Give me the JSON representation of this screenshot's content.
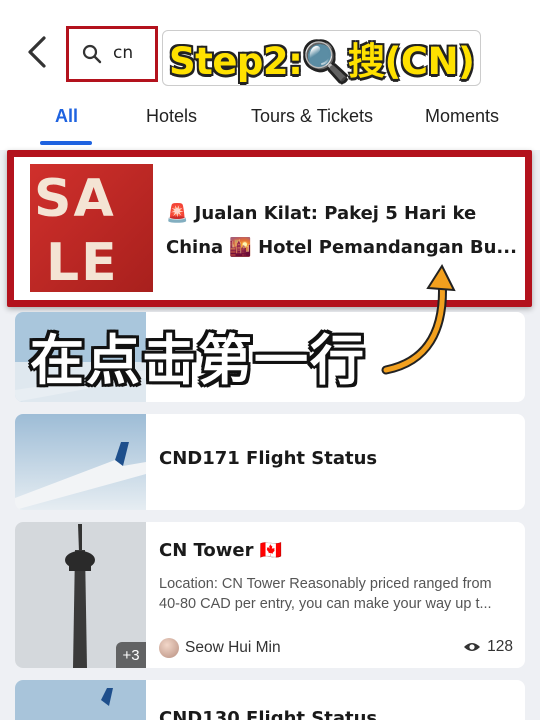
{
  "search": {
    "query": "cn"
  },
  "banner": {
    "step_text": "Step2:🔍搜(CN)"
  },
  "tabs": [
    {
      "label": "All",
      "active": true
    },
    {
      "label": "Hotels",
      "active": false
    },
    {
      "label": "Tours & Tickets",
      "active": false
    },
    {
      "label": "Moments",
      "active": false
    }
  ],
  "results": [
    {
      "title_line1": "🚨 Jualan Kilat: Pakej 5 Hari ke",
      "title_line2": "China 🌇 Hotel Pemandangan Bu...",
      "thumb_text": "SALE"
    },
    {
      "title": "CND171 Flight Status"
    },
    {
      "title": "CN Tower 🇨🇦",
      "description": "Location: CN Tower  Reasonably priced ranged from 40-80 CAD per entry, you can make your way up t...",
      "author": "Seow Hui Min",
      "views": "128",
      "more_images": "+3"
    },
    {
      "title": "CND130 Flight Status"
    }
  ],
  "overlay": {
    "instruction": "在点击第一行"
  },
  "colors": {
    "accent": "#1f63e0",
    "highlight": "#b3121d",
    "banner_text": "#ffe100",
    "arrow": "#f2a01e"
  }
}
